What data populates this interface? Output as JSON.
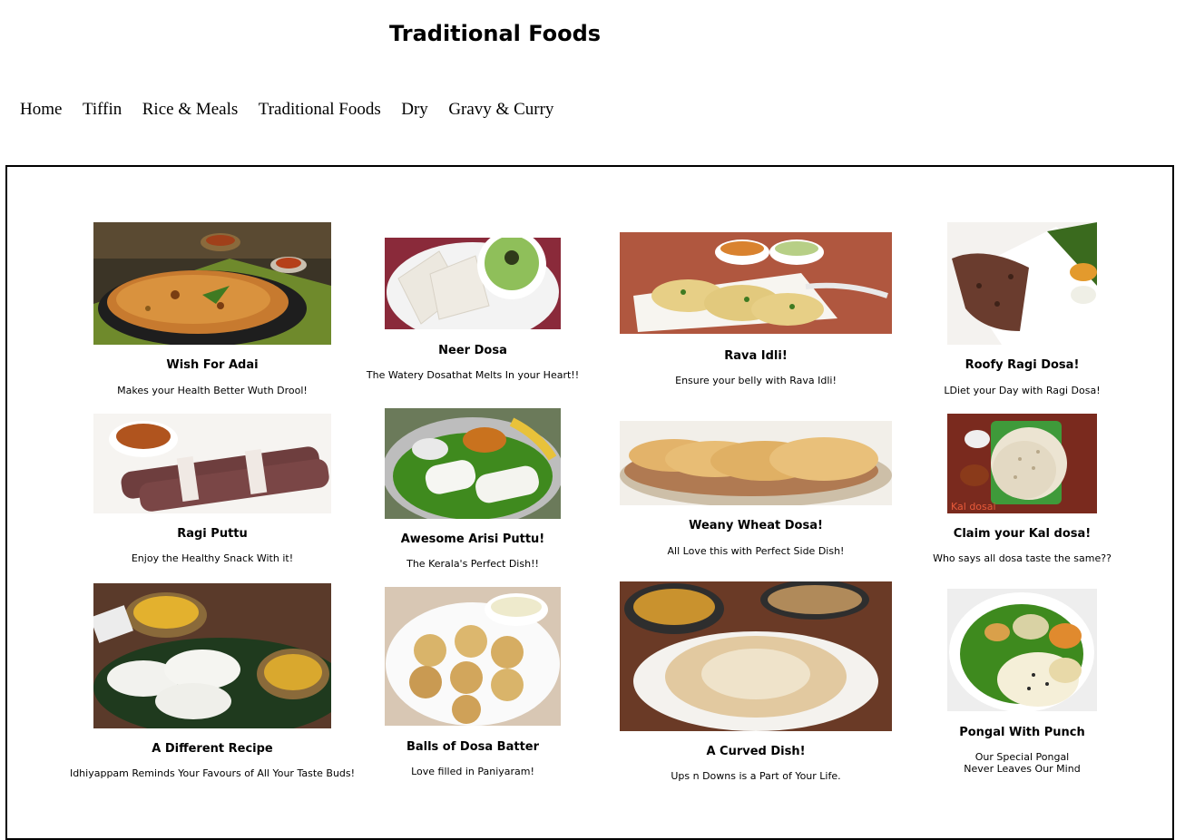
{
  "header": {
    "title": "Traditional Foods"
  },
  "nav": {
    "items": [
      "Home",
      "Tiffin",
      "Rice & Meals",
      "Traditional Foods",
      "Dry",
      "Gravy & Curry"
    ]
  },
  "cards": [
    {
      "name": "Wish For Adai",
      "desc": "Makes your Health Better Wuth Drool!",
      "image": "adai-photo"
    },
    {
      "name": "Neer Dosa",
      "desc": "The Watery Dosathat Melts In your Heart!!",
      "image": "neer-dosa-photo"
    },
    {
      "name": "Rava Idli!",
      "desc": "Ensure your belly with Rava Idli!",
      "image": "rava-idli-photo"
    },
    {
      "name": "Roofy Ragi Dosa!",
      "desc": "LDiet your Day with Ragi Dosa!",
      "image": "ragi-dosa-photo"
    },
    {
      "name": "Ragi Puttu",
      "desc": "Enjoy the Healthy Snack With it!",
      "image": "ragi-puttu-photo"
    },
    {
      "name": "Awesome Arisi Puttu!",
      "desc": "The Kerala's Perfect Dish!!",
      "image": "arisi-puttu-photo"
    },
    {
      "name": "Weany Wheat Dosa!",
      "desc": "All Love this with Perfect Side Dish!",
      "image": "wheat-dosa-photo"
    },
    {
      "name": "Claim your Kal dosa!",
      "desc": "Who says all dosa taste the same??",
      "image": "kal-dosa-photo",
      "image_caption": "Kal dosai"
    },
    {
      "name": "A Different Recipe",
      "desc": "Idhiyappam Reminds Your Favours of All Your Taste Buds!",
      "image": "idiyappam-photo"
    },
    {
      "name": "Balls of Dosa Batter",
      "desc": "Love filled in Paniyaram!",
      "image": "paniyaram-photo"
    },
    {
      "name": "A Curved Dish!",
      "desc": "Ups n Downs is a Part of Your Life.",
      "image": "appam-photo"
    },
    {
      "name": "Pongal With Punch",
      "desc": "Our Special Pongal\nNever Leaves Our Mind",
      "image": "pongal-photo"
    }
  ]
}
